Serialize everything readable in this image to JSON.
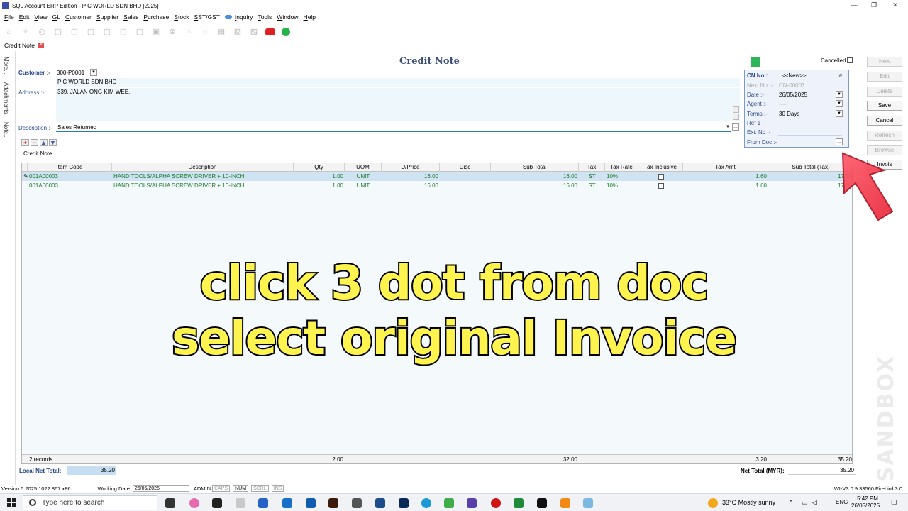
{
  "window": {
    "title": "SQL Account ERP Edition - P C WORLD SDN BHD [2025]"
  },
  "menu": [
    "File",
    "Edit",
    "View",
    "GL",
    "Customer",
    "Supplier",
    "Sales",
    "Purchase",
    "Stock",
    "SST/GST",
    "Inquiry",
    "Tools",
    "Window",
    "Help"
  ],
  "tab": {
    "label": "Credit Note"
  },
  "side_tabs": [
    "More...",
    "Attachments",
    "Note..."
  ],
  "form": {
    "title": "Credit Note",
    "customer_label": "Customer :-",
    "customer_code": "300-P0001",
    "customer_name": "P C WORLD SDN BHD",
    "address_label": "Address :-",
    "address": "339, JALAN ONG KIM WEE,",
    "description_label": "Description :-",
    "description": "Sales Returned",
    "cancelled_label": "Cancelled"
  },
  "cn": {
    "cn_no_label": "CN No :",
    "cn_no": "<<New>>",
    "next_no_label": "Next No :-",
    "next_no": "CN-00003",
    "date_label": "Date :-",
    "date": "26/05/2025",
    "agent_label": "Agent :-",
    "agent": "----",
    "terms_label": "Terms :-",
    "terms": "30 Days",
    "ref1_label": "Ref 1 :-",
    "extno_label": "Ext. No :-",
    "fromdoc_label": "From Doc :-"
  },
  "buttons": {
    "new": "New",
    "edit": "Edit",
    "delete": "Delete",
    "save": "Save",
    "cancel": "Cancel",
    "refresh": "Refresh",
    "browse": "Browse",
    "invois": "Invois"
  },
  "grid": {
    "tab": "Credit Note",
    "headers": [
      "Item Code",
      "Description",
      "Qty",
      "UOM",
      "U/Price",
      "Disc",
      "Sub Total",
      "Tax",
      "Tax Rate",
      "Tax Inclusive",
      "Tax Amt",
      "Sub Total (Tax)"
    ],
    "rows": [
      {
        "code": "001A00003",
        "desc": "HAND TOOLS/ALPHA SCREW DRIVER + 10-INCH",
        "qty": "1.00",
        "uom": "UNIT",
        "price": "16.00",
        "disc": "",
        "subtotal": "16.00",
        "tax": "ST",
        "rate": "10%",
        "amt": "1.60",
        "subtax": "17.60"
      },
      {
        "code": "001A00003",
        "desc": "HAND TOOLS/ALPHA SCREW DRIVER + 10-INCH",
        "qty": "1.00",
        "uom": "UNIT",
        "price": "16.00",
        "disc": "",
        "subtotal": "16.00",
        "tax": "ST",
        "rate": "10%",
        "amt": "1.60",
        "subtax": "17.60"
      }
    ],
    "footer": {
      "records": "2 records",
      "qty": "2.00",
      "subtotal": "32.00",
      "tax_amt": "3.20",
      "subtotal_tax": "35.20"
    }
  },
  "totals": {
    "local_label": "Local Net Total:",
    "local_value": "35.20",
    "net_label": "Net Total (MYR):",
    "net_value": "35.20"
  },
  "overlay": {
    "line1": "click 3 dot from doc",
    "line2": "select original Invoice"
  },
  "watermark": "SANDBOX",
  "status": {
    "version": "Version 5.2025.1022.867 x86",
    "working_date_label": "Working Date",
    "working_date": "26/05/2025",
    "user": "ADMIN",
    "caps": "CAPS",
    "num": "NUM",
    "scrl": "SCRL",
    "ins": "INS",
    "build": "WI-V3.0.9.33560 Firebird 3.0"
  },
  "taskbar": {
    "search_placeholder": "Type here to search",
    "weather": "33°C  Mostly sunny",
    "lang": "ENG",
    "time": "5:42 PM",
    "date": "26/05/2025"
  }
}
